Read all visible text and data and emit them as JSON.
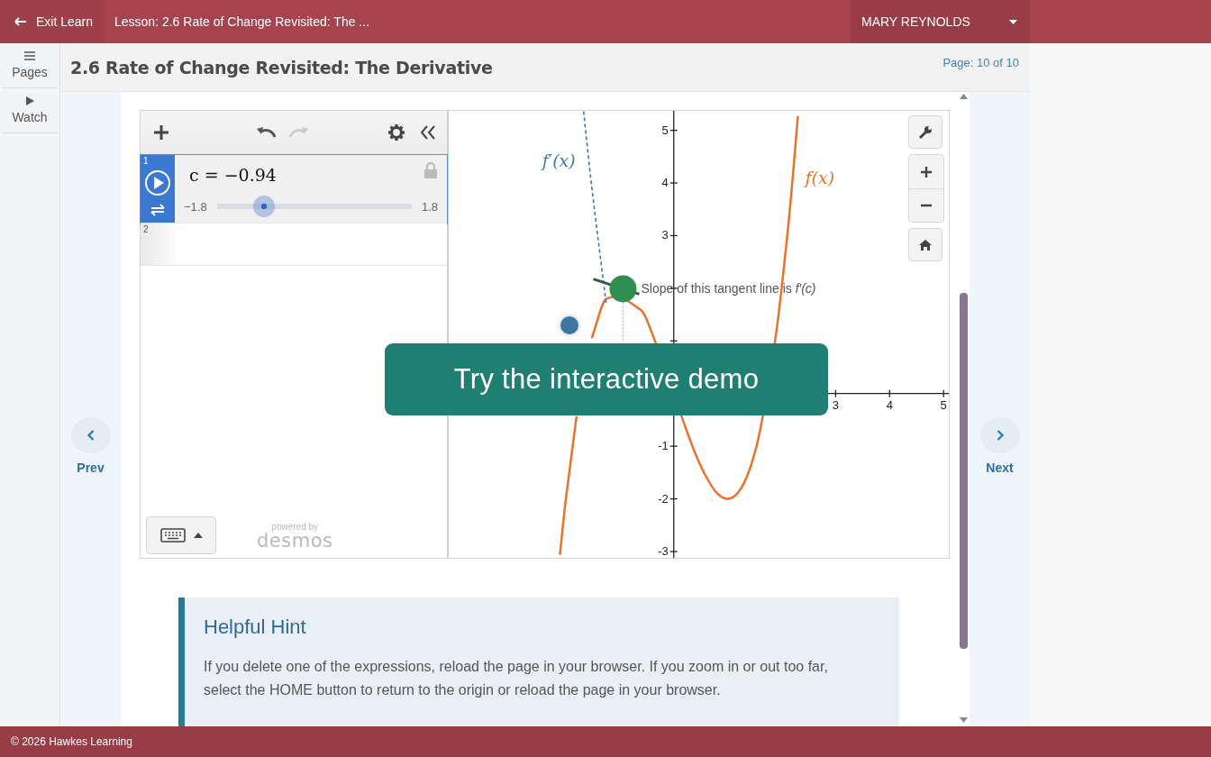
{
  "top_bar": {
    "exit": "Exit Learn",
    "lesson": "Lesson: 2.6 Rate of Change Revisited: The ...",
    "user": "MARY REYNOLDS"
  },
  "rail": [
    {
      "kind": "pages",
      "label": "Pages"
    },
    {
      "kind": "watch",
      "label": "Watch"
    }
  ],
  "header": {
    "title": "2.6 Rate of Change Revisited: The Derivative",
    "page": "Page: 10 of 10"
  },
  "nav": {
    "prev": "Prev",
    "next": "Next"
  },
  "calculator": {
    "toolbar": {
      "undo_disabled": false,
      "redo_disabled": true
    },
    "expressions": [
      {
        "number": "1",
        "kind": "slider",
        "selected": true,
        "text": "c = −0.94",
        "min": "−1.8",
        "max": "1.8",
        "level": 0.24
      },
      {
        "number": "2",
        "kind": "empty",
        "selected": false
      }
    ],
    "branding": [
      "powered by",
      "desmos"
    ],
    "graph": {
      "chart_data": {
        "type": "line",
        "xlim": [
          -4.17,
          5.13
        ],
        "ylim": [
          -3.12,
          5.37
        ],
        "xticks": [
          3,
          4,
          5
        ],
        "yticks": [
          -3,
          -2,
          -1,
          3,
          4,
          5
        ],
        "x": [
          -2.11,
          -2.0,
          -1.8,
          -1.67,
          -1.52,
          -1.25,
          -0.6,
          -0.4,
          0.2,
          0.4,
          0.6,
          0.8,
          1.0,
          1.2,
          1.4,
          1.6,
          1.9,
          2.1,
          2.2,
          2.3
        ],
        "series": [
          {
            "name": "f(x)",
            "color": "#e8742c",
            "line_style": "solid",
            "values": [
              -3.06,
              -2,
              -0.43,
              null,
              1.05,
              1.8,
              1.58,
              1.14,
              -0.59,
              -1.14,
              -1.58,
              -1.89,
              -2,
              -1.87,
              -1.46,
              -0.7,
              1.16,
              2.96,
              4.05,
              5.27
            ]
          },
          {
            "name": "f′(x)",
            "color": "#3d78b0",
            "line_style": "dashed",
            "values": [
              null,
              null,
              null,
              5.36,
              3.93,
              1.69,
              null,
              null,
              null,
              null,
              null,
              null,
              null,
              null,
              null,
              null,
              null,
              null,
              null,
              null
            ]
          }
        ],
        "annotations": [
          {
            "text": "Slope of this tangent line is *f′(c)*",
            "x": -0.94,
            "y": 1.99
          }
        ]
      }
    }
  },
  "demo": "Try the interactive demo",
  "hint": {
    "title": "Helpful Hint",
    "text": "If you delete one of the expressions, reload the page in your browser. If you zoom in or out too far, select the HOME button to return to the origin or reload the page in your browser."
  },
  "footer": "© 2026 Hawkes Learning"
}
